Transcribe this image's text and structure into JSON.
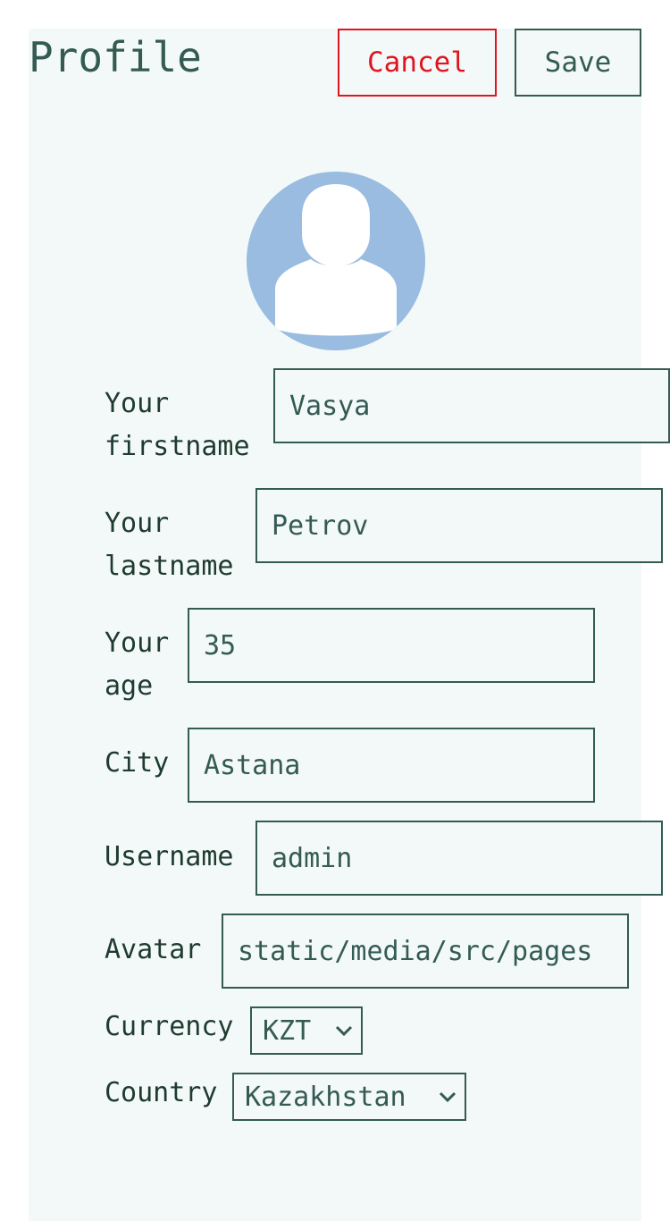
{
  "header": {
    "title": "Profile",
    "cancel_label": "Cancel",
    "save_label": "Save"
  },
  "avatar": {
    "icon": "user-avatar-icon",
    "bg_color": "#99bce0"
  },
  "form": {
    "firstname": {
      "label_line1": "Your",
      "label_line2": "firstname",
      "value": "Vasya"
    },
    "lastname": {
      "label_line1": "Your",
      "label_line2": "lastname",
      "value": "Petrov"
    },
    "age": {
      "label_line1": "Your",
      "label_line2": "age",
      "value": "35"
    },
    "city": {
      "label": "City",
      "value": "Astana"
    },
    "username": {
      "label": "Username",
      "value": "admin"
    },
    "avatar_path": {
      "label": "Avatar",
      "value": "static/media/src/pages"
    },
    "currency": {
      "label": "Currency",
      "selected": "KZT"
    },
    "country": {
      "label": "Country",
      "selected": "Kazakhstan"
    }
  },
  "colors": {
    "accent": "#345b52",
    "danger": "#e0141e",
    "panel_bg": "#f3f9f8"
  }
}
